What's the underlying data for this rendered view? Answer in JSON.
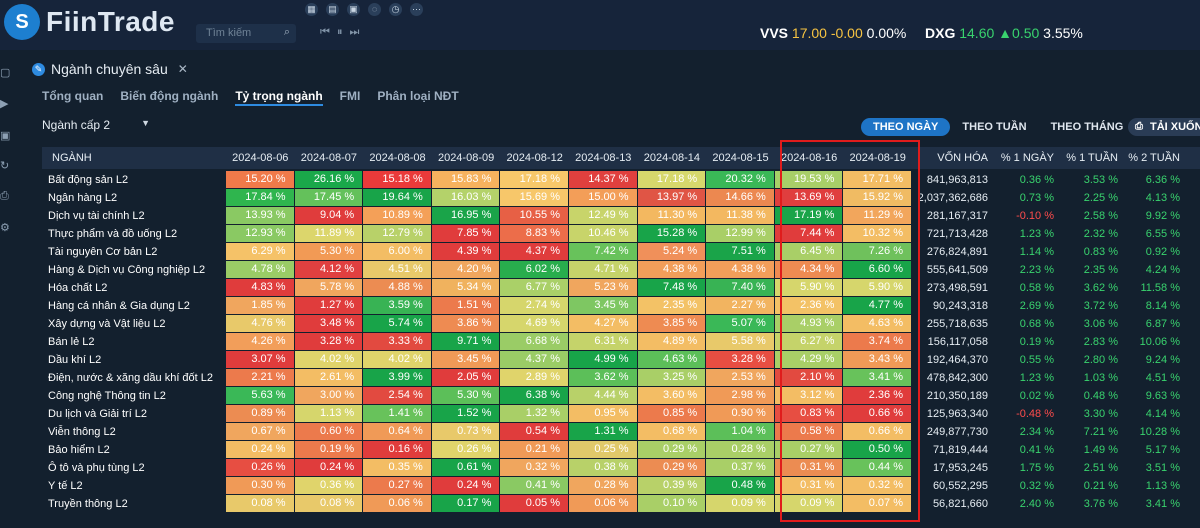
{
  "app": {
    "brand": "FiinTrade",
    "logo_letter": "S"
  },
  "toolbar": {
    "icons": [
      "grid-icon",
      "chart-icon",
      "layout-icon",
      "settings-icon",
      "clock-icon",
      "more-icon"
    ]
  },
  "search": {
    "placeholder": "Tìm kiếm"
  },
  "media": {
    "controls": "⏮ ⏸ ⏭"
  },
  "tickers": [
    {
      "symbol": "VVS",
      "price": "17.00",
      "change": "-0.00",
      "pct": "0.00%",
      "price_color": "#f6c342",
      "change_color": "#f6c342"
    },
    {
      "symbol": "DXG",
      "price": "14.60",
      "change": "▲0.50",
      "pct": "3.55%",
      "price_color": "#39d36e",
      "change_color": "#39d36e"
    }
  ],
  "panel": {
    "title": "Ngành chuyên sâu",
    "close": "✕"
  },
  "subtabs": [
    "Tổng quan",
    "Biến động ngành",
    "Tỷ trọng ngành",
    "FMI",
    "Phân loại NĐT"
  ],
  "active_subtab": 2,
  "sector_select": {
    "value": "Ngành cấp 2"
  },
  "periods": [
    "THEO NGÀY",
    "THEO TUẦN",
    "THEO THÁNG"
  ],
  "active_period": 0,
  "download": {
    "label": "TẢI XUỐNG"
  },
  "table": {
    "col_name": "NGÀNH",
    "dates": [
      "2024-08-06",
      "2024-08-07",
      "2024-08-08",
      "2024-08-09",
      "2024-08-12",
      "2024-08-13",
      "2024-08-14",
      "2024-08-15",
      "2024-08-16",
      "2024-08-19"
    ],
    "col_cap": "VỐN HÓA",
    "col_1d": "% 1 NGÀY",
    "col_1w": "% 1 TUẦN",
    "col_2w": "% 2 TUẦN",
    "rows": [
      {
        "name": "Bất động sản L2",
        "vals": [
          "15.20 %",
          "26.16 %",
          "15.18 %",
          "15.83 %",
          "17.18 %",
          "14.37 %",
          "17.18 %",
          "20.32 %",
          "19.53 %",
          "17.71 %"
        ],
        "colors": [
          "#f07a4a",
          "#1aa84a",
          "#ea3a3a",
          "#f6b25e",
          "#f7c86a",
          "#e0403e",
          "#d6d86c",
          "#3ab857",
          "#a8cf68",
          "#f3bd64"
        ],
        "cap": "841,963,813",
        "d1": "0.36 %",
        "w1": "3.53 %",
        "w2": "6.36 %",
        "d1s": "pos"
      },
      {
        "name": "Ngân hàng L2",
        "vals": [
          "17.84 %",
          "17.45 %",
          "19.64 %",
          "16.03 %",
          "15.69 %",
          "15.00 %",
          "13.97 %",
          "14.66 %",
          "13.69 %",
          "15.92 %"
        ],
        "colors": [
          "#2fb54e",
          "#64c15b",
          "#18a449",
          "#b4d26a",
          "#f7c76a",
          "#f39e58",
          "#e05545",
          "#ec8850",
          "#e03e3e",
          "#f0bb63"
        ],
        "cap": "2,037,362,686",
        "d1": "0.73 %",
        "w1": "2.25 %",
        "w2": "4.13 %",
        "d1s": "pos"
      },
      {
        "name": "Dịch vụ tài chính L2",
        "vals": [
          "13.93 %",
          "9.04 %",
          "10.89 %",
          "16.95 %",
          "10.55 %",
          "12.49 %",
          "11.30 %",
          "11.38 %",
          "17.19 %",
          "11.29 %"
        ],
        "colors": [
          "#8ac963",
          "#e03c3c",
          "#f4a058",
          "#1aa449",
          "#e76045",
          "#c8d46a",
          "#f3b860",
          "#f3b860",
          "#1aa449",
          "#f2a65c"
        ],
        "cap": "281,167,317",
        "d1": "-0.10 %",
        "w1": "2.58 %",
        "w2": "9.92 %",
        "d1s": "neg"
      },
      {
        "name": "Thực phẩm và đồ uống L2",
        "vals": [
          "12.93 %",
          "11.89 %",
          "12.79 %",
          "7.85 %",
          "8.83 %",
          "10.46 %",
          "15.28 %",
          "12.99 %",
          "7.44 %",
          "10.32 %"
        ],
        "colors": [
          "#8ac963",
          "#dcd66c",
          "#b8d169",
          "#e03c3c",
          "#ec6d4a",
          "#c8d46a",
          "#18a449",
          "#a9cf67",
          "#e03c3c",
          "#f3bd64"
        ],
        "cap": "721,713,428",
        "d1": "1.23 %",
        "w1": "2.32 %",
        "w2": "6.55 %",
        "d1s": "pos"
      },
      {
        "name": "Tài nguyên Cơ bản L2",
        "vals": [
          "6.29 %",
          "5.30 %",
          "6.00 %",
          "4.39 %",
          "4.37 %",
          "7.42 %",
          "5.24 %",
          "7.51 %",
          "6.45 %",
          "7.26 %"
        ],
        "colors": [
          "#f5c268",
          "#f29a55",
          "#f3bd64",
          "#e03c3c",
          "#e03c3c",
          "#68c25b",
          "#f0905a",
          "#1aa449",
          "#a9cf67",
          "#6fc15c"
        ],
        "cap": "276,824,891",
        "d1": "1.14 %",
        "w1": "0.83 %",
        "w2": "0.92 %",
        "d1s": "pos"
      },
      {
        "name": "Hàng & Dịch vụ Công nghiệp L2",
        "vals": [
          "4.78 %",
          "4.12 %",
          "4.51 %",
          "4.20 %",
          "6.02 %",
          "4.71 %",
          "4.38 %",
          "4.38 %",
          "4.34 %",
          "6.60 %"
        ],
        "colors": [
          "#9acc66",
          "#e04040",
          "#e8c96a",
          "#f0a65e",
          "#28ad4d",
          "#c5d36a",
          "#f29e5a",
          "#f29e5a",
          "#ee8b52",
          "#18a449"
        ],
        "cap": "555,641,509",
        "d1": "2.23 %",
        "w1": "2.35 %",
        "w2": "4.24 %",
        "d1s": "pos"
      },
      {
        "name": "Hóa chất L2",
        "vals": [
          "4.83 %",
          "5.78 %",
          "4.88 %",
          "5.34 %",
          "6.77 %",
          "5.23 %",
          "7.48 %",
          "7.40 %",
          "5.90 %",
          "5.90 %"
        ],
        "colors": [
          "#e03c3c",
          "#f0a65e",
          "#ec8c52",
          "#f0b25e",
          "#aad068",
          "#f0a65e",
          "#18a449",
          "#38b354",
          "#d6d66c",
          "#d6d66c"
        ],
        "cap": "273,498,591",
        "d1": "0.58 %",
        "w1": "3.62 %",
        "w2": "11.58 %",
        "d1s": "pos"
      },
      {
        "name": "Hàng cá nhân & Gia dụng L2",
        "vals": [
          "1.85 %",
          "1.27 %",
          "3.59 %",
          "1.51 %",
          "2.74 %",
          "3.45 %",
          "2.35 %",
          "2.27 %",
          "2.36 %",
          "4.77 %"
        ],
        "colors": [
          "#f0a65e",
          "#e03c3c",
          "#38b354",
          "#ec7a4c",
          "#d6d66c",
          "#7ec762",
          "#f3c266",
          "#f2b460",
          "#f3c266",
          "#18a449"
        ],
        "cap": "90,243,318",
        "d1": "2.69 %",
        "w1": "3.72 %",
        "w2": "8.14 %",
        "d1s": "pos"
      },
      {
        "name": "Xây dựng và Vật liệu L2",
        "vals": [
          "4.76 %",
          "3.48 %",
          "5.74 %",
          "3.86 %",
          "4.69 %",
          "4.27 %",
          "3.85 %",
          "5.07 %",
          "4.93 %",
          "4.63 %"
        ],
        "colors": [
          "#e8c96a",
          "#e03c3c",
          "#18a449",
          "#ee8b52",
          "#d6d66c",
          "#f3bd64",
          "#ee8b52",
          "#3ab857",
          "#a9cf67",
          "#f3bd64"
        ],
        "cap": "255,718,635",
        "d1": "0.68 %",
        "w1": "3.06 %",
        "w2": "6.87 %",
        "d1s": "pos"
      },
      {
        "name": "Bán lẻ L2",
        "vals": [
          "4.26 %",
          "3.28 %",
          "3.33 %",
          "9.71 %",
          "6.68 %",
          "6.31 %",
          "4.89 %",
          "5.58 %",
          "6.27 %",
          "3.74 %"
        ],
        "colors": [
          "#f29e5a",
          "#e03c3c",
          "#e24a40",
          "#18a449",
          "#9acc66",
          "#c5d36a",
          "#f3bd64",
          "#e8c96a",
          "#c5d36a",
          "#ec7a4c"
        ],
        "cap": "156,117,058",
        "d1": "0.19 %",
        "w1": "2.83 %",
        "w2": "10.06 %",
        "d1s": "pos"
      },
      {
        "name": "Dầu khí L2",
        "vals": [
          "3.07 %",
          "4.02 %",
          "4.02 %",
          "3.45 %",
          "4.37 %",
          "4.99 %",
          "4.63 %",
          "3.28 %",
          "4.29 %",
          "3.43 %"
        ],
        "colors": [
          "#e03c3c",
          "#e0d46b",
          "#e0d46b",
          "#f09a57",
          "#9acc66",
          "#18a449",
          "#5cbf59",
          "#e74e42",
          "#a9cf67",
          "#f09a57"
        ],
        "cap": "192,464,370",
        "d1": "0.55 %",
        "w1": "2.80 %",
        "w2": "9.24 %",
        "d1s": "pos"
      },
      {
        "name": "Điện, nước & xăng dầu khí đốt L2",
        "vals": [
          "2.21 %",
          "2.61 %",
          "3.99 %",
          "2.05 %",
          "2.89 %",
          "3.62 %",
          "3.25 %",
          "2.53 %",
          "2.10 %",
          "3.41 %"
        ],
        "colors": [
          "#ec7a4c",
          "#f3bd64",
          "#18a449",
          "#e03c3c",
          "#e0d46b",
          "#5cbf59",
          "#a9cf67",
          "#f0a65e",
          "#e24a40",
          "#68c25b"
        ],
        "cap": "478,842,300",
        "d1": "1.23 %",
        "w1": "1.03 %",
        "w2": "4.51 %",
        "d1s": "pos"
      },
      {
        "name": "Công nghệ Thông tin L2",
        "vals": [
          "5.63 %",
          "3.00 %",
          "2.54 %",
          "5.30 %",
          "6.38 %",
          "4.44 %",
          "3.60 %",
          "2.98 %",
          "3.12 %",
          "2.36 %"
        ],
        "colors": [
          "#3ab857",
          "#f0a65e",
          "#e24a40",
          "#5cbf59",
          "#18a449",
          "#b8d169",
          "#f3bd64",
          "#f09a57",
          "#f3bd64",
          "#e03c3c"
        ],
        "cap": "210,350,189",
        "d1": "0.02 %",
        "w1": "0.48 %",
        "w2": "9.63 %",
        "d1s": "pos"
      },
      {
        "name": "Du lịch và Giải trí L2",
        "vals": [
          "0.89 %",
          "1.13 %",
          "1.41 %",
          "1.52 %",
          "1.32 %",
          "0.95 %",
          "0.85 %",
          "0.90 %",
          "0.83 %",
          "0.66 %"
        ],
        "colors": [
          "#ec8c52",
          "#d6d66c",
          "#68c25b",
          "#18a449",
          "#a9cf67",
          "#f3bd64",
          "#ec7a4c",
          "#f09a57",
          "#e74e42",
          "#e03c3c"
        ],
        "cap": "125,963,340",
        "d1": "-0.48 %",
        "w1": "3.30 %",
        "w2": "4.14 %",
        "d1s": "neg"
      },
      {
        "name": "Viễn thông L2",
        "vals": [
          "0.67 %",
          "0.60 %",
          "0.64 %",
          "0.73 %",
          "0.54 %",
          "1.31 %",
          "0.68 %",
          "1.04 %",
          "0.58 %",
          "0.66 %"
        ],
        "colors": [
          "#f0a65e",
          "#ec7a4c",
          "#f09a57",
          "#e8c96a",
          "#e03c3c",
          "#18a449",
          "#f3bd64",
          "#5cbf59",
          "#ec7a4c",
          "#f3bd64"
        ],
        "cap": "249,877,730",
        "d1": "2.34 %",
        "w1": "7.21 %",
        "w2": "10.28 %",
        "d1s": "pos"
      },
      {
        "name": "Bảo hiểm L2",
        "vals": [
          "0.24 %",
          "0.19 %",
          "0.16 %",
          "0.26 %",
          "0.21 %",
          "0.25 %",
          "0.29 %",
          "0.28 %",
          "0.27 %",
          "0.50 %"
        ],
        "colors": [
          "#f3bd64",
          "#ec7a4c",
          "#e03c3c",
          "#e0d46b",
          "#f09a57",
          "#e0c96a",
          "#a9cf67",
          "#a9cf67",
          "#a9cf67",
          "#18a449"
        ],
        "cap": "71,819,444",
        "d1": "0.41 %",
        "w1": "1.49 %",
        "w2": "5.17 %",
        "d1s": "pos"
      },
      {
        "name": "Ô tô và phụ tùng L2",
        "vals": [
          "0.26 %",
          "0.24 %",
          "0.35 %",
          "0.61 %",
          "0.32 %",
          "0.38 %",
          "0.29 %",
          "0.37 %",
          "0.31 %",
          "0.44 %"
        ],
        "colors": [
          "#e74e42",
          "#e03c3c",
          "#f3bd64",
          "#18a449",
          "#f0a65e",
          "#b8d169",
          "#ec8c52",
          "#a9cf67",
          "#ec8c52",
          "#68c25b"
        ],
        "cap": "17,953,245",
        "d1": "1.75 %",
        "w1": "2.51 %",
        "w2": "3.51 %",
        "d1s": "pos"
      },
      {
        "name": "Y tế L2",
        "vals": [
          "0.30 %",
          "0.36 %",
          "0.27 %",
          "0.24 %",
          "0.41 %",
          "0.28 %",
          "0.39 %",
          "0.48 %",
          "0.31 %",
          "0.32 %"
        ],
        "colors": [
          "#f09a57",
          "#e0d46b",
          "#ec7a4c",
          "#e03c3c",
          "#8ac963",
          "#f0a65e",
          "#b8d169",
          "#18a449",
          "#f3bd64",
          "#f3bd64"
        ],
        "cap": "60,552,295",
        "d1": "0.32 %",
        "w1": "0.21 %",
        "w2": "1.13 %",
        "d1s": "pos"
      },
      {
        "name": "Truyền thông L2",
        "vals": [
          "0.08 %",
          "0.08 %",
          "0.06 %",
          "0.17 %",
          "0.05 %",
          "0.06 %",
          "0.10 %",
          "0.09 %",
          "0.09 %",
          "0.07 %"
        ],
        "colors": [
          "#e8c96a",
          "#e8c96a",
          "#f09a57",
          "#18a449",
          "#e03c3c",
          "#f09a57",
          "#a9cf67",
          "#d6d66c",
          "#d6d66c",
          "#f3bd64"
        ],
        "cap": "56,821,660",
        "d1": "2.40 %",
        "w1": "3.76 %",
        "w2": "3.41 %",
        "d1s": "pos"
      }
    ]
  }
}
